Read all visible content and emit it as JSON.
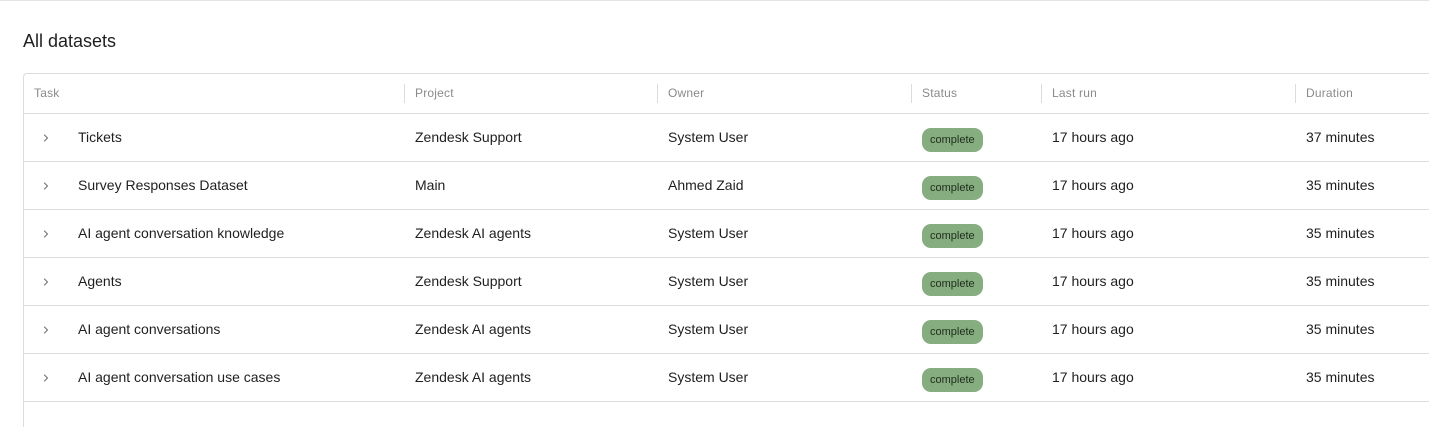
{
  "page": {
    "title": "All datasets"
  },
  "table": {
    "columns": [
      "Task",
      "Project",
      "Owner",
      "Status",
      "Last run",
      "Duration"
    ],
    "rows": [
      {
        "task": "Tickets",
        "project": "Zendesk Support",
        "owner": "System User",
        "status": "complete",
        "last_run": "17 hours ago",
        "duration": "37 minutes"
      },
      {
        "task": "Survey Responses Dataset",
        "project": "Main",
        "owner": "Ahmed Zaid",
        "status": "complete",
        "last_run": "17 hours ago",
        "duration": "35 minutes"
      },
      {
        "task": "AI agent conversation knowledge",
        "project": "Zendesk AI agents",
        "owner": "System User",
        "status": "complete",
        "last_run": "17 hours ago",
        "duration": "35 minutes"
      },
      {
        "task": "Agents",
        "project": "Zendesk Support",
        "owner": "System User",
        "status": "complete",
        "last_run": "17 hours ago",
        "duration": "35 minutes"
      },
      {
        "task": "AI agent conversations",
        "project": "Zendesk AI agents",
        "owner": "System User",
        "status": "complete",
        "last_run": "17 hours ago",
        "duration": "35 minutes"
      },
      {
        "task": "AI agent conversation use cases",
        "project": "Zendesk AI agents",
        "owner": "System User",
        "status": "complete",
        "last_run": "17 hours ago",
        "duration": "35 minutes"
      }
    ]
  },
  "colors": {
    "status_complete": "#86ad80",
    "border": "#dcdcdc",
    "header_text": "#8a8a8a"
  },
  "icons": {
    "row_expand": "chevron-right-icon"
  }
}
